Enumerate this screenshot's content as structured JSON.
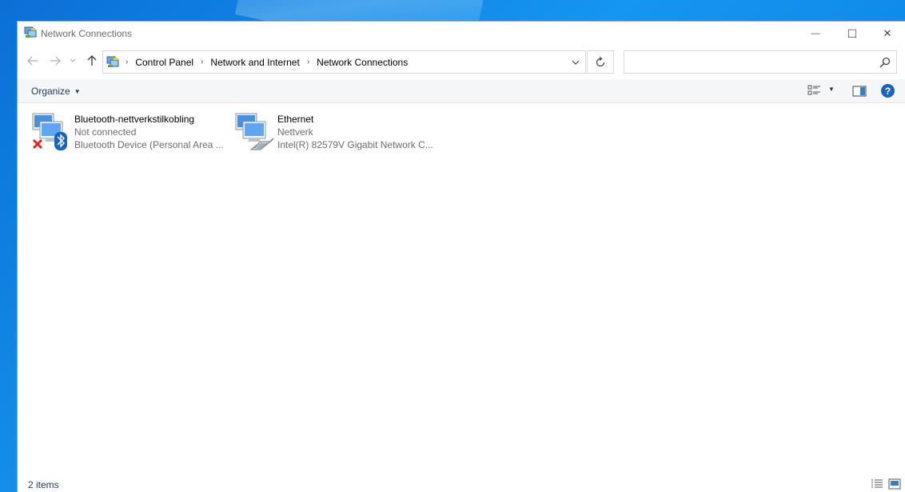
{
  "window": {
    "title": "Network Connections",
    "controls": {
      "minimize": "—",
      "maximize": "☐",
      "close": "✕"
    }
  },
  "navigation": {
    "breadcrumbs": [
      "Control Panel",
      "Network and Internet",
      "Network Connections"
    ],
    "search_placeholder": ""
  },
  "toolbar": {
    "organize_label": "Organize"
  },
  "connections": [
    {
      "name": "Bluetooth-nettverkstilkobling",
      "status": "Not connected",
      "device": "Bluetooth Device (Personal Area ...",
      "icon": "bluetooth-network-icon"
    },
    {
      "name": "Ethernet",
      "status": "Nettverk",
      "device": "Intel(R) 82579V Gigabit Network C...",
      "icon": "ethernet-network-icon"
    }
  ],
  "statusbar": {
    "item_count": "2 items"
  },
  "colors": {
    "accent": "#1a63b8",
    "desktop": "#0b78dd",
    "command_bar": "#f5f6f7"
  }
}
